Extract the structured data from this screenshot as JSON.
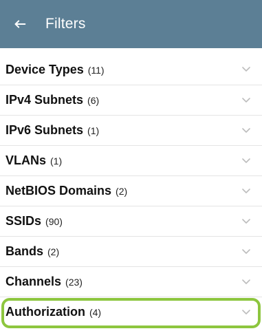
{
  "header": {
    "back_icon": "arrow-left-icon",
    "title": "Filters"
  },
  "filters": [
    {
      "name": "Device Types",
      "count": "(11)"
    },
    {
      "name": "IPv4 Subnets",
      "count": "(6)"
    },
    {
      "name": "IPv6 Subnets",
      "count": "(1)"
    },
    {
      "name": "VLANs",
      "count": "(1)"
    },
    {
      "name": "NetBIOS Domains",
      "count": "(2)"
    },
    {
      "name": "SSIDs",
      "count": "(90)"
    },
    {
      "name": "Bands",
      "count": "(2)"
    },
    {
      "name": "Channels",
      "count": "(23)"
    },
    {
      "name": "Authorization",
      "count": "(4)"
    }
  ],
  "colors": {
    "header_bg": "#5c7f95",
    "highlight": "#8dc63f"
  },
  "icons": {
    "expand": "chevron-down-icon"
  }
}
